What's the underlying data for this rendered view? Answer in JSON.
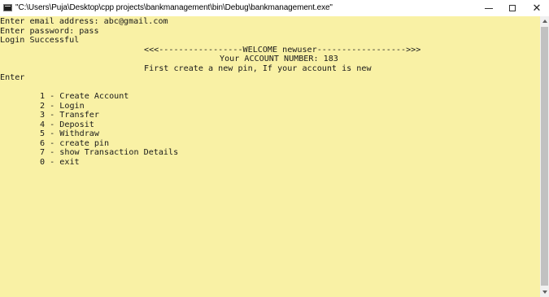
{
  "window": {
    "title": "\"C:\\Users\\Puja\\Desktop\\cpp projects\\bankmanagement\\bin\\Debug\\bankmanagement.exe\"",
    "minimize_icon": "minimize-icon",
    "maximize_icon": "maximize-icon",
    "close_icon": "close-icon",
    "close_glyph": "✕"
  },
  "console": {
    "background": "#f9f1a5",
    "text_color": "#1a1a1a",
    "email_prompt": "Enter email address: abc@gmail.com",
    "password_prompt": "Enter password: pass",
    "login_status": "Login Successful",
    "welcome_banner": "<<<-----------------WELCOME newuser------------------>>>",
    "account_number": "Your ACCOUNT NUMBER: 183",
    "pin_notice": "First create a new pin, If your account is new",
    "enter_prompt": "Enter",
    "menu": [
      "1 - Create Account",
      "2 - Login",
      "3 - Transfer",
      "4 - Deposit",
      "5 - Withdraw",
      "6 - create pin",
      "7 - show Transaction Details",
      "0 - exit"
    ]
  }
}
